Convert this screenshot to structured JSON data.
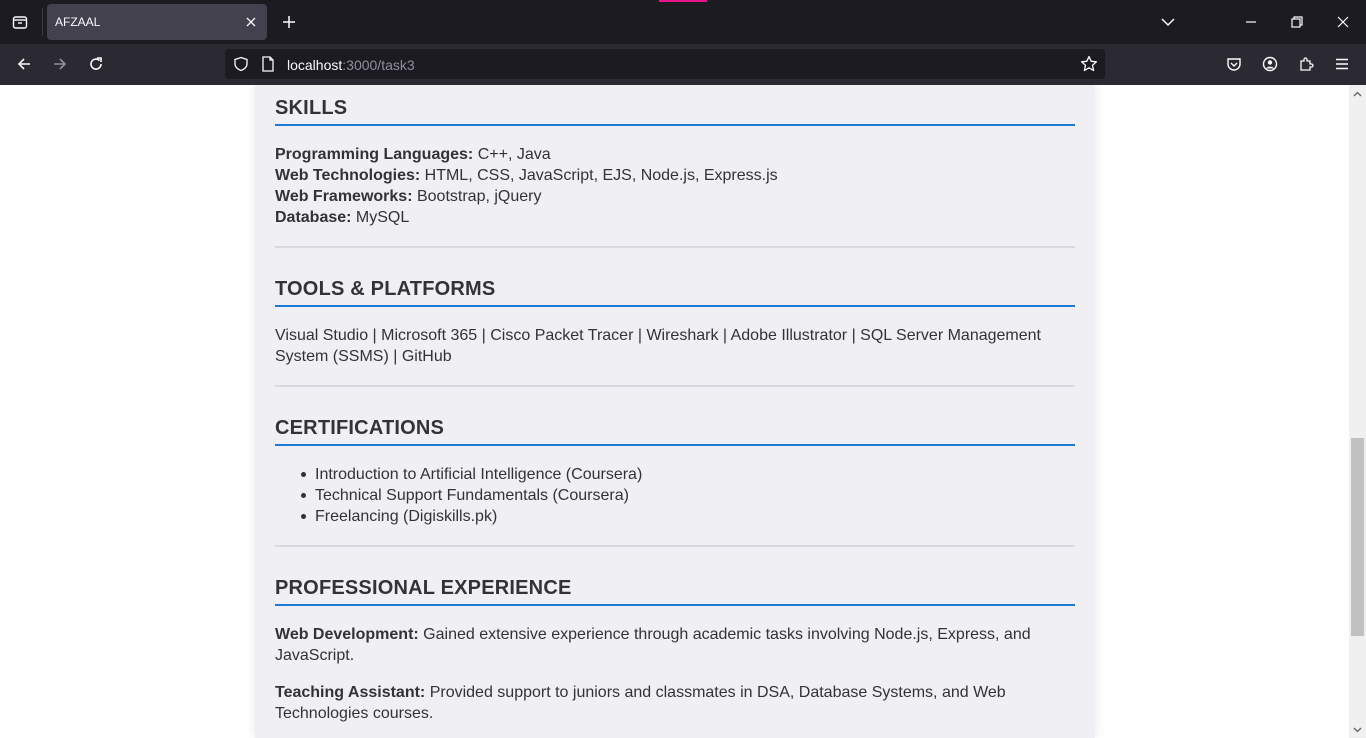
{
  "browser": {
    "tab_title": "AFZAAL",
    "url_host": "localhost",
    "url_path": ":3000/task3"
  },
  "skills": {
    "title": "SKILLS",
    "items": [
      {
        "label": "Programming Languages:",
        "value": " C++, Java"
      },
      {
        "label": "Web Technologies:",
        "value": " HTML, CSS, JavaScript, EJS, Node.js, Express.js"
      },
      {
        "label": "Web Frameworks:",
        "value": " Bootstrap, jQuery"
      },
      {
        "label": "Database:",
        "value": " MySQL"
      }
    ]
  },
  "tools": {
    "title": "TOOLS & PLATFORMS",
    "text": "Visual Studio | Microsoft 365 | Cisco Packet Tracer | Wireshark | Adobe Illustrator | SQL Server Management System (SSMS) | GitHub"
  },
  "certifications": {
    "title": "CERTIFICATIONS",
    "items": [
      "Introduction to Artificial Intelligence (Coursera)",
      "Technical Support Fundamentals (Coursera)",
      "Freelancing (Digiskills.pk)"
    ]
  },
  "experience": {
    "title": "PROFESSIONAL EXPERIENCE",
    "items": [
      {
        "label": "Web Development:",
        "value": " Gained extensive experience through academic tasks involving Node.js, Express, and JavaScript."
      },
      {
        "label": "Teaching Assistant:",
        "value": " Provided support to juniors and classmates in DSA, Database Systems, and Web Technologies courses."
      }
    ]
  },
  "colors": {
    "accent": "#1e7bd3",
    "chrome_dark": "#1c1b22",
    "sheet_bg": "#efeff4"
  }
}
